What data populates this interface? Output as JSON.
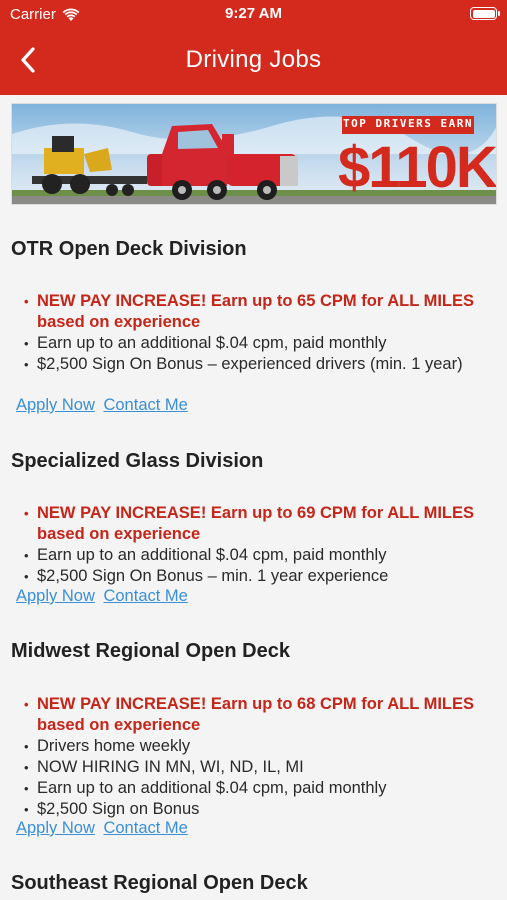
{
  "status_bar": {
    "carrier": "Carrier",
    "time": "9:27 AM"
  },
  "nav": {
    "title": "Driving Jobs",
    "back_icon": "chevron-left-icon"
  },
  "banner": {
    "badge": "TOP DRIVERS EARN",
    "amount": "$110K"
  },
  "colors": {
    "brand_red": "#d42a1e",
    "highlight_red": "#c4261a",
    "link_blue": "#3a8fd6"
  },
  "sections": [
    {
      "title": "OTR Open Deck Division",
      "bullets": [
        {
          "text": "NEW PAY INCREASE! Earn up to 65 CPM for ALL MILES based on experience",
          "highlight": true
        },
        {
          "text": "Earn up to an additional $.04 cpm, paid monthly",
          "highlight": false
        },
        {
          "text": "$2,500  Sign On Bonus – experienced drivers (min. 1 year)",
          "highlight": false
        }
      ],
      "apply_label": "Apply Now",
      "contact_label": "Contact Me"
    },
    {
      "title": "Specialized Glass Division",
      "bullets": [
        {
          "text": "NEW PAY INCREASE! Earn up to 69 CPM for ALL MILES based on experience",
          "highlight": true
        },
        {
          "text": "Earn up to an additional $.04 cpm, paid monthly",
          "highlight": false
        },
        {
          "text": "$2,500 Sign On Bonus – min. 1 year experience",
          "highlight": false
        }
      ],
      "apply_label": "Apply Now",
      "contact_label": "Contact Me"
    },
    {
      "title": "Midwest Regional Open Deck",
      "bullets": [
        {
          "text": "NEW PAY INCREASE! Earn up to 68 CPM for ALL MILES based on experience",
          "highlight": true
        },
        {
          "text": "Drivers home weekly",
          "highlight": false
        },
        {
          "text": "NOW HIRING IN MN, WI, ND, IL, MI",
          "highlight": false
        },
        {
          "text": "Earn up to an additional $.04 cpm, paid monthly",
          "highlight": false
        },
        {
          "text": "$2,500 Sign on Bonus",
          "highlight": false
        }
      ],
      "apply_label": "Apply Now",
      "contact_label": "Contact Me"
    },
    {
      "title": "Southeast Regional Open Deck",
      "bullets": [],
      "apply_label": "",
      "contact_label": ""
    }
  ]
}
